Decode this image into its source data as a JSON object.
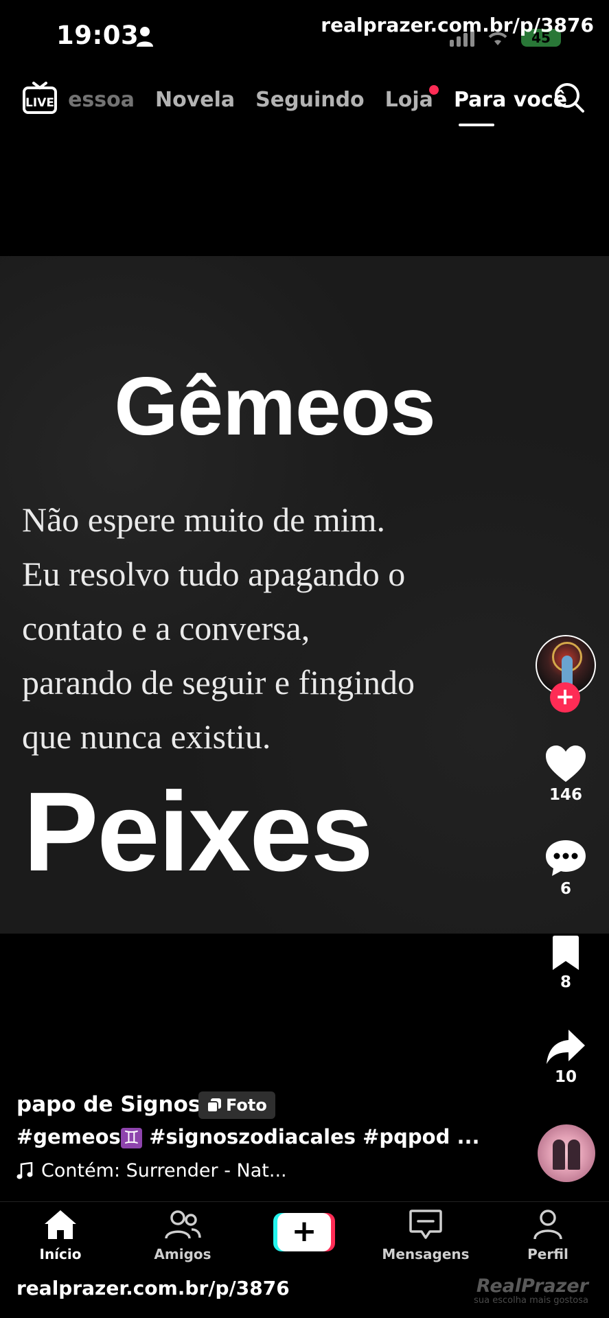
{
  "status_bar": {
    "time": "19:03",
    "battery": "45"
  },
  "watermark": {
    "top": "realprazer.com.br/p/3876",
    "bottom": "realprazer.com.br/p/3876"
  },
  "top_nav": {
    "live_label": "LIVE",
    "tabs": [
      {
        "label": "Pessoa"
      },
      {
        "label": "Novela"
      },
      {
        "label": "Seguindo"
      },
      {
        "label": "Loja"
      },
      {
        "label": "Para você"
      }
    ]
  },
  "post": {
    "title": "Gêmeos",
    "quote_lines": [
      "Não espere muito de mim.",
      "Eu resolvo tudo apagando o",
      "contato e a conversa,",
      "parando de seguir e fingindo",
      "que nunca existiu."
    ],
    "subtitle": "Peixes"
  },
  "actions": {
    "likes": "146",
    "comments": "6",
    "saves": "8",
    "shares": "10"
  },
  "caption": {
    "author": "papo de Signos",
    "badge": "Foto",
    "hashtag_1": "#gemeos",
    "gemini_symbol": "♊",
    "hashtags_rest": " #signoszodiacales #pqpod ...",
    "music": "Contém: Surrender - Nat..."
  },
  "bottom_nav": {
    "items": [
      {
        "label": "Início"
      },
      {
        "label": "Amigos"
      },
      {
        "label": "Mensagens"
      },
      {
        "label": "Perfil"
      }
    ]
  },
  "brand": {
    "name": "RealPrazer",
    "tagline": "sua escolha mais gostosa"
  },
  "colors": {
    "accent": "#fe2c55",
    "cyan": "#25f4ee",
    "background": "#000000",
    "battery": "#4cd964"
  }
}
